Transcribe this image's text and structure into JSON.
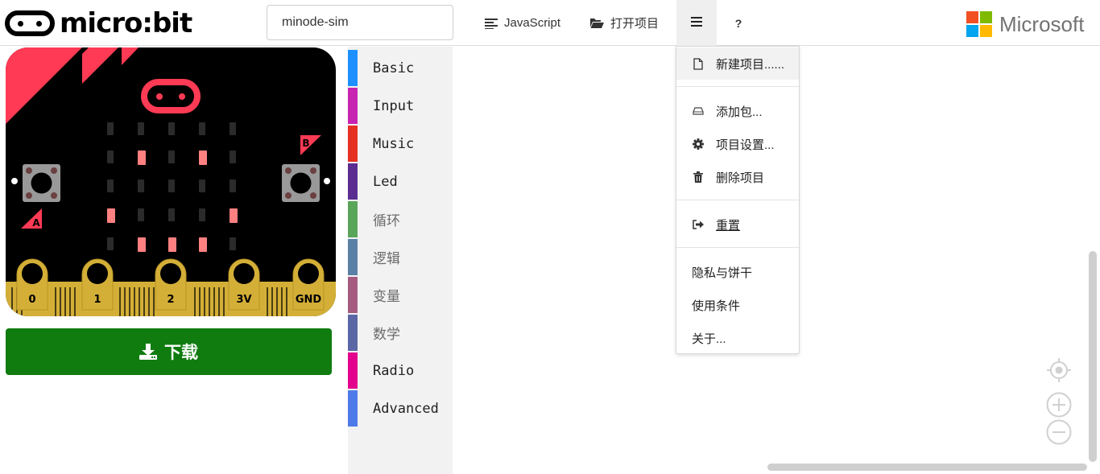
{
  "header": {
    "logo_text": "micro:bit",
    "project_name": "minode-sim",
    "javascript_label": "JavaScript",
    "open_label": "打开项目",
    "help_label": "?",
    "brand_text": "Microsoft"
  },
  "simulator": {
    "pins": [
      "0",
      "1",
      "2",
      "3V",
      "GND"
    ],
    "button_a": "A",
    "button_b": "B"
  },
  "download_label": "下载",
  "toolbox": {
    "categories": [
      {
        "label": "Basic",
        "color": "#1e90ff"
      },
      {
        "label": "Input",
        "color": "#c724b1"
      },
      {
        "label": "Music",
        "color": "#e63022"
      },
      {
        "label": "Led",
        "color": "#5c2d91"
      },
      {
        "label": "循环",
        "color": "#5ba55b"
      },
      {
        "label": "逻辑",
        "color": "#5b80a5"
      },
      {
        "label": "变量",
        "color": "#a55b80"
      },
      {
        "label": "数学",
        "color": "#5b67a5"
      },
      {
        "label": "Radio",
        "color": "#e3008c"
      },
      {
        "label": "Advanced",
        "color": "#4e7ae9"
      }
    ]
  },
  "menu": {
    "new_project": "新建项目......",
    "add_package": "添加包...",
    "project_settings": "项目设置...",
    "delete_project": "删除项目",
    "reset": "重置",
    "privacy": "隐私与饼干",
    "terms": "使用条件",
    "about": "关于..."
  },
  "colors": {
    "download": "#107c10",
    "accent_red": "#ff3a54",
    "gold": "#d4af37",
    "led_on": "#ff8080",
    "led_off": "#2b2b2b"
  },
  "icons": [
    "javascript-icon",
    "folder-open-icon",
    "hamburger-icon",
    "download-icon",
    "file-icon",
    "drive-icon",
    "gear-icon",
    "trash-icon",
    "sign-out-icon",
    "target-icon",
    "zoom-in-icon",
    "zoom-out-icon"
  ]
}
